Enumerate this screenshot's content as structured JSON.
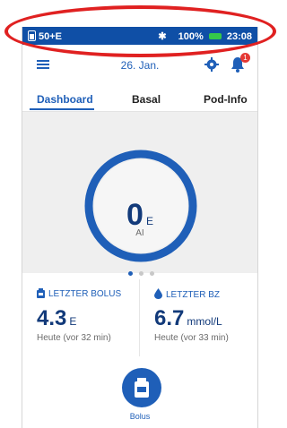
{
  "status_bar": {
    "left_text": "50+E",
    "battery_percent": "100%",
    "time": "23:08"
  },
  "header": {
    "date": "26. Jan.",
    "notification_count": "1"
  },
  "tabs": [
    {
      "label": "Dashboard",
      "active": true
    },
    {
      "label": "Basal",
      "active": false
    },
    {
      "label": "Pod-Info",
      "active": false
    }
  ],
  "gauge": {
    "value": "0",
    "unit": "E",
    "label": "AI"
  },
  "cards": {
    "bolus": {
      "title": "LETZTER BOLUS",
      "value": "4.3",
      "unit": "E",
      "subtitle": "Heute (vor 32 min)"
    },
    "bz": {
      "title": "LETZTER BZ",
      "value": "6.7",
      "unit": "mmol/L",
      "subtitle": "Heute (vor 33 min)"
    }
  },
  "bolus_button": {
    "label": "Bolus"
  },
  "colors": {
    "primary": "#1f5fb8",
    "statusbar": "#0f4fa6",
    "highlight": "#e02121"
  }
}
